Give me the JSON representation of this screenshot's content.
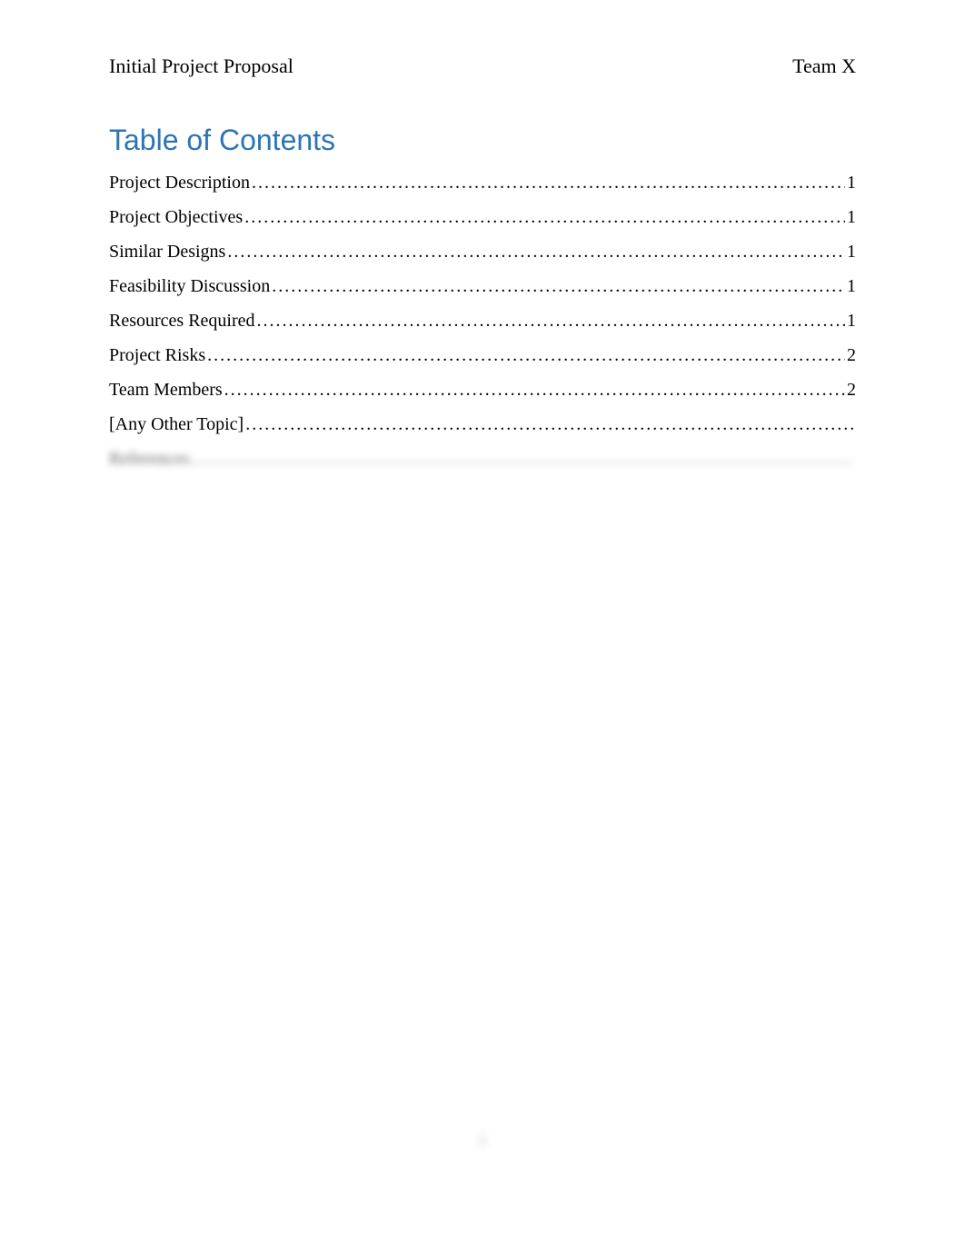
{
  "header": {
    "left": "Initial Project Proposal",
    "right": "Team X"
  },
  "toc": {
    "title": "Table of Contents",
    "entries": [
      {
        "label": "Project Description",
        "page": "1"
      },
      {
        "label": "Project Objectives",
        "page": "1"
      },
      {
        "label": "Similar Designs",
        "page": "1"
      },
      {
        "label": "Feasibility Discussion",
        "page": "1"
      },
      {
        "label": "Resources Required",
        "page": "1"
      },
      {
        "label": "Project Risks",
        "page": "2"
      },
      {
        "label": "Team Members",
        "page": "2"
      },
      {
        "label": "[Any Other Topic]",
        "page": ""
      },
      {
        "label": "References",
        "page": ""
      }
    ]
  },
  "footer": {
    "page_number": "ii"
  }
}
